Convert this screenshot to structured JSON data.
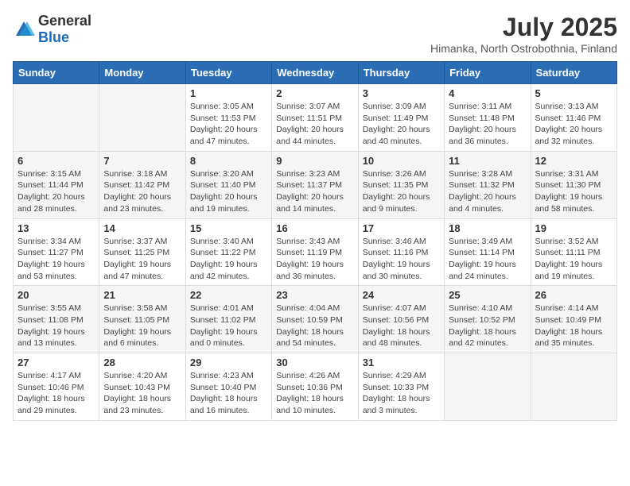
{
  "header": {
    "logo_general": "General",
    "logo_blue": "Blue",
    "title": "July 2025",
    "subtitle": "Himanka, North Ostrobothnia, Finland"
  },
  "weekdays": [
    "Sunday",
    "Monday",
    "Tuesday",
    "Wednesday",
    "Thursday",
    "Friday",
    "Saturday"
  ],
  "weeks": [
    [
      {
        "day": "",
        "sunrise": "",
        "sunset": "",
        "daylight": ""
      },
      {
        "day": "",
        "sunrise": "",
        "sunset": "",
        "daylight": ""
      },
      {
        "day": "1",
        "sunrise": "Sunrise: 3:05 AM",
        "sunset": "Sunset: 11:53 PM",
        "daylight": "Daylight: 20 hours and 47 minutes."
      },
      {
        "day": "2",
        "sunrise": "Sunrise: 3:07 AM",
        "sunset": "Sunset: 11:51 PM",
        "daylight": "Daylight: 20 hours and 44 minutes."
      },
      {
        "day": "3",
        "sunrise": "Sunrise: 3:09 AM",
        "sunset": "Sunset: 11:49 PM",
        "daylight": "Daylight: 20 hours and 40 minutes."
      },
      {
        "day": "4",
        "sunrise": "Sunrise: 3:11 AM",
        "sunset": "Sunset: 11:48 PM",
        "daylight": "Daylight: 20 hours and 36 minutes."
      },
      {
        "day": "5",
        "sunrise": "Sunrise: 3:13 AM",
        "sunset": "Sunset: 11:46 PM",
        "daylight": "Daylight: 20 hours and 32 minutes."
      }
    ],
    [
      {
        "day": "6",
        "sunrise": "Sunrise: 3:15 AM",
        "sunset": "Sunset: 11:44 PM",
        "daylight": "Daylight: 20 hours and 28 minutes."
      },
      {
        "day": "7",
        "sunrise": "Sunrise: 3:18 AM",
        "sunset": "Sunset: 11:42 PM",
        "daylight": "Daylight: 20 hours and 23 minutes."
      },
      {
        "day": "8",
        "sunrise": "Sunrise: 3:20 AM",
        "sunset": "Sunset: 11:40 PM",
        "daylight": "Daylight: 20 hours and 19 minutes."
      },
      {
        "day": "9",
        "sunrise": "Sunrise: 3:23 AM",
        "sunset": "Sunset: 11:37 PM",
        "daylight": "Daylight: 20 hours and 14 minutes."
      },
      {
        "day": "10",
        "sunrise": "Sunrise: 3:26 AM",
        "sunset": "Sunset: 11:35 PM",
        "daylight": "Daylight: 20 hours and 9 minutes."
      },
      {
        "day": "11",
        "sunrise": "Sunrise: 3:28 AM",
        "sunset": "Sunset: 11:32 PM",
        "daylight": "Daylight: 20 hours and 4 minutes."
      },
      {
        "day": "12",
        "sunrise": "Sunrise: 3:31 AM",
        "sunset": "Sunset: 11:30 PM",
        "daylight": "Daylight: 19 hours and 58 minutes."
      }
    ],
    [
      {
        "day": "13",
        "sunrise": "Sunrise: 3:34 AM",
        "sunset": "Sunset: 11:27 PM",
        "daylight": "Daylight: 19 hours and 53 minutes."
      },
      {
        "day": "14",
        "sunrise": "Sunrise: 3:37 AM",
        "sunset": "Sunset: 11:25 PM",
        "daylight": "Daylight: 19 hours and 47 minutes."
      },
      {
        "day": "15",
        "sunrise": "Sunrise: 3:40 AM",
        "sunset": "Sunset: 11:22 PM",
        "daylight": "Daylight: 19 hours and 42 minutes."
      },
      {
        "day": "16",
        "sunrise": "Sunrise: 3:43 AM",
        "sunset": "Sunset: 11:19 PM",
        "daylight": "Daylight: 19 hours and 36 minutes."
      },
      {
        "day": "17",
        "sunrise": "Sunrise: 3:46 AM",
        "sunset": "Sunset: 11:16 PM",
        "daylight": "Daylight: 19 hours and 30 minutes."
      },
      {
        "day": "18",
        "sunrise": "Sunrise: 3:49 AM",
        "sunset": "Sunset: 11:14 PM",
        "daylight": "Daylight: 19 hours and 24 minutes."
      },
      {
        "day": "19",
        "sunrise": "Sunrise: 3:52 AM",
        "sunset": "Sunset: 11:11 PM",
        "daylight": "Daylight: 19 hours and 19 minutes."
      }
    ],
    [
      {
        "day": "20",
        "sunrise": "Sunrise: 3:55 AM",
        "sunset": "Sunset: 11:08 PM",
        "daylight": "Daylight: 19 hours and 13 minutes."
      },
      {
        "day": "21",
        "sunrise": "Sunrise: 3:58 AM",
        "sunset": "Sunset: 11:05 PM",
        "daylight": "Daylight: 19 hours and 6 minutes."
      },
      {
        "day": "22",
        "sunrise": "Sunrise: 4:01 AM",
        "sunset": "Sunset: 11:02 PM",
        "daylight": "Daylight: 19 hours and 0 minutes."
      },
      {
        "day": "23",
        "sunrise": "Sunrise: 4:04 AM",
        "sunset": "Sunset: 10:59 PM",
        "daylight": "Daylight: 18 hours and 54 minutes."
      },
      {
        "day": "24",
        "sunrise": "Sunrise: 4:07 AM",
        "sunset": "Sunset: 10:56 PM",
        "daylight": "Daylight: 18 hours and 48 minutes."
      },
      {
        "day": "25",
        "sunrise": "Sunrise: 4:10 AM",
        "sunset": "Sunset: 10:52 PM",
        "daylight": "Daylight: 18 hours and 42 minutes."
      },
      {
        "day": "26",
        "sunrise": "Sunrise: 4:14 AM",
        "sunset": "Sunset: 10:49 PM",
        "daylight": "Daylight: 18 hours and 35 minutes."
      }
    ],
    [
      {
        "day": "27",
        "sunrise": "Sunrise: 4:17 AM",
        "sunset": "Sunset: 10:46 PM",
        "daylight": "Daylight: 18 hours and 29 minutes."
      },
      {
        "day": "28",
        "sunrise": "Sunrise: 4:20 AM",
        "sunset": "Sunset: 10:43 PM",
        "daylight": "Daylight: 18 hours and 23 minutes."
      },
      {
        "day": "29",
        "sunrise": "Sunrise: 4:23 AM",
        "sunset": "Sunset: 10:40 PM",
        "daylight": "Daylight: 18 hours and 16 minutes."
      },
      {
        "day": "30",
        "sunrise": "Sunrise: 4:26 AM",
        "sunset": "Sunset: 10:36 PM",
        "daylight": "Daylight: 18 hours and 10 minutes."
      },
      {
        "day": "31",
        "sunrise": "Sunrise: 4:29 AM",
        "sunset": "Sunset: 10:33 PM",
        "daylight": "Daylight: 18 hours and 3 minutes."
      },
      {
        "day": "",
        "sunrise": "",
        "sunset": "",
        "daylight": ""
      },
      {
        "day": "",
        "sunrise": "",
        "sunset": "",
        "daylight": ""
      }
    ]
  ]
}
